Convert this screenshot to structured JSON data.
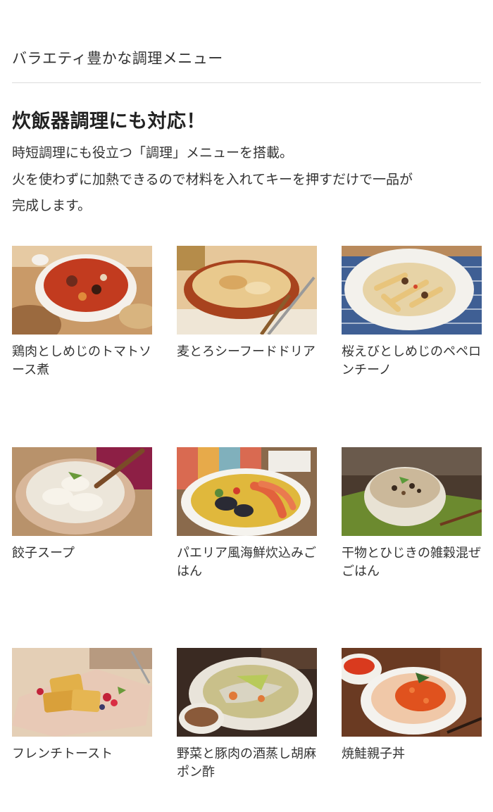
{
  "section_title": "バラエティ豊かな調理メニュー",
  "headline": "炊飯器調理にも対応！",
  "description_lines": [
    "時短調理にも役立つ「調理」メニューを搭載。",
    "火を使わずに加熱できるので材料を入れてキーを押すだけで一品が",
    "完成します。"
  ],
  "menus": [
    {
      "label": "鶏肉としめじのトマトソース煮"
    },
    {
      "label": "麦とろシーフードドリア"
    },
    {
      "label": "桜えびとしめじのペペロンチーノ"
    },
    {
      "label": "餃子スープ"
    },
    {
      "label": "パエリア風海鮮炊込みごはん"
    },
    {
      "label": "干物とひじきの雑穀混ぜごはん"
    },
    {
      "label": "フレンチトースト"
    },
    {
      "label": "野菜と豚肉の酒蒸し胡麻ポン酢"
    },
    {
      "label": "焼鮭親子丼"
    }
  ]
}
